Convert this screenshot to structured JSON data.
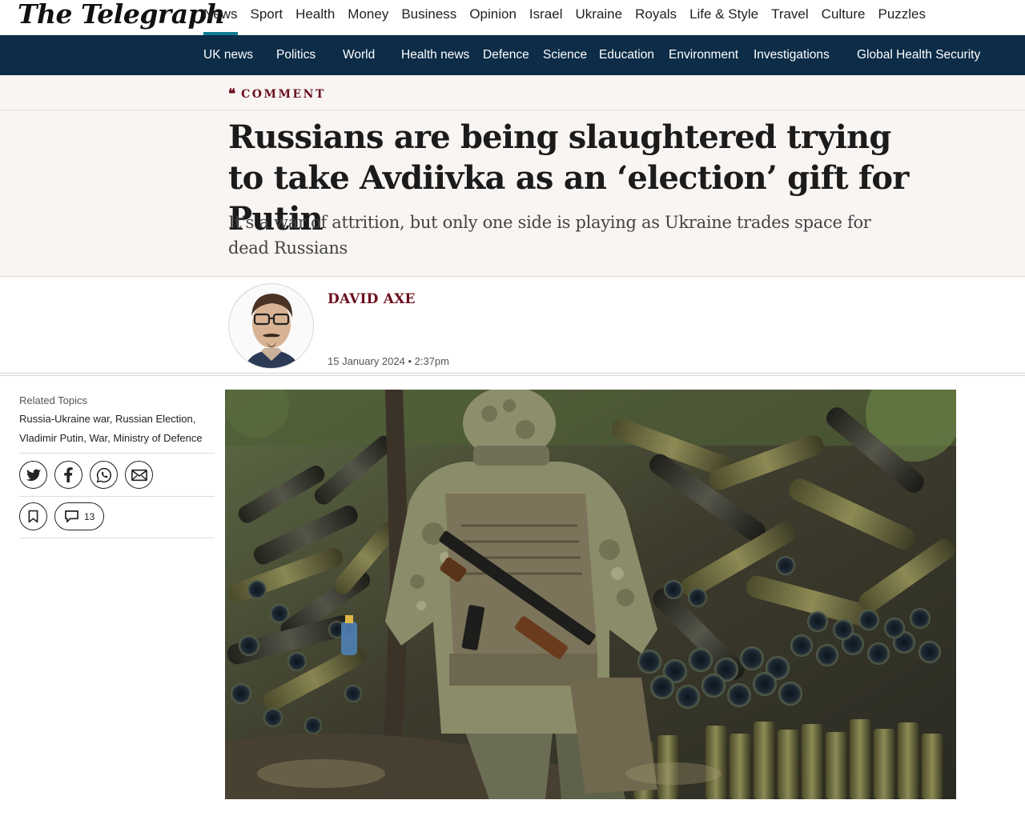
{
  "site": {
    "logo": "The Telegraph"
  },
  "topnav": {
    "items": [
      "News",
      "Sport",
      "Health",
      "Money",
      "Business",
      "Opinion",
      "Israel",
      "Ukraine",
      "Royals",
      "Life & Style",
      "Travel",
      "Culture",
      "Puzzles"
    ],
    "active": "News"
  },
  "subnav": {
    "items": [
      "UK news",
      "Politics",
      "World",
      "Health news",
      "Defence",
      "Science",
      "Education",
      "Environment",
      "Investigations",
      "Global Health Security"
    ]
  },
  "article": {
    "kicker": "COMMENT",
    "kicker_icon": "quote-icon",
    "headline": "Russians are being slaughtered trying to take Avdiivka as an ‘election’ gift for Putin",
    "standfirst": "It's a war of attrition, but only one side is playing as Ukraine trades space for dead Russians",
    "author": "DAVID AXE",
    "dateline": "15 January 2024 • 2:37pm"
  },
  "sidebar": {
    "related_label": "Related Topics",
    "topics": [
      "Russia-Ukraine war",
      "Russian Election",
      "Vladimir Putin",
      "War",
      "Ministry of Defence"
    ],
    "share_icons": [
      "twitter-icon",
      "facebook-icon",
      "whatsapp-icon",
      "email-icon"
    ],
    "comments_count": "13"
  },
  "colors": {
    "accent_teal": "#0f7d91",
    "subnav_bg": "#0c2c47",
    "kicker_maroon": "#6b0f1e",
    "header_bg": "#f8f5f3"
  }
}
